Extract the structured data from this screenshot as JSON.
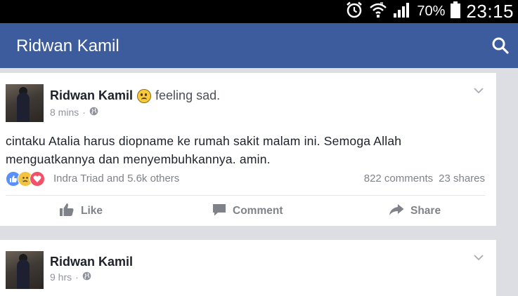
{
  "status_bar": {
    "battery_percent": "70%",
    "time": "23:15",
    "icons": [
      "alarm-icon",
      "wifi-icon",
      "signal-icon",
      "battery-icon"
    ]
  },
  "app_bar": {
    "title": "Ridwan Kamil",
    "search_icon": "search-icon",
    "color": "#3d5c9d"
  },
  "posts": [
    {
      "author": "Ridwan Kamil",
      "feeling": "feeling sad.",
      "time": "8 mins",
      "separator": "·",
      "privacy_icon": "globe-icon",
      "text": "cintaku Atalia harus diopname ke rumah sakit malam ini. Semoga Allah menguatkannya dan menyembuhkannya. amin.",
      "reaction_icons": [
        "like-icon",
        "sad-icon",
        "love-icon"
      ],
      "reactions_text": "Indra Triad and 5.6k others",
      "comments": "822 comments",
      "shares": "23 shares",
      "actions": {
        "like": "Like",
        "comment": "Comment",
        "share": "Share"
      }
    },
    {
      "author": "Ridwan Kamil",
      "time": "9 hrs",
      "separator": "·",
      "privacy_icon": "globe-icon"
    }
  ]
}
